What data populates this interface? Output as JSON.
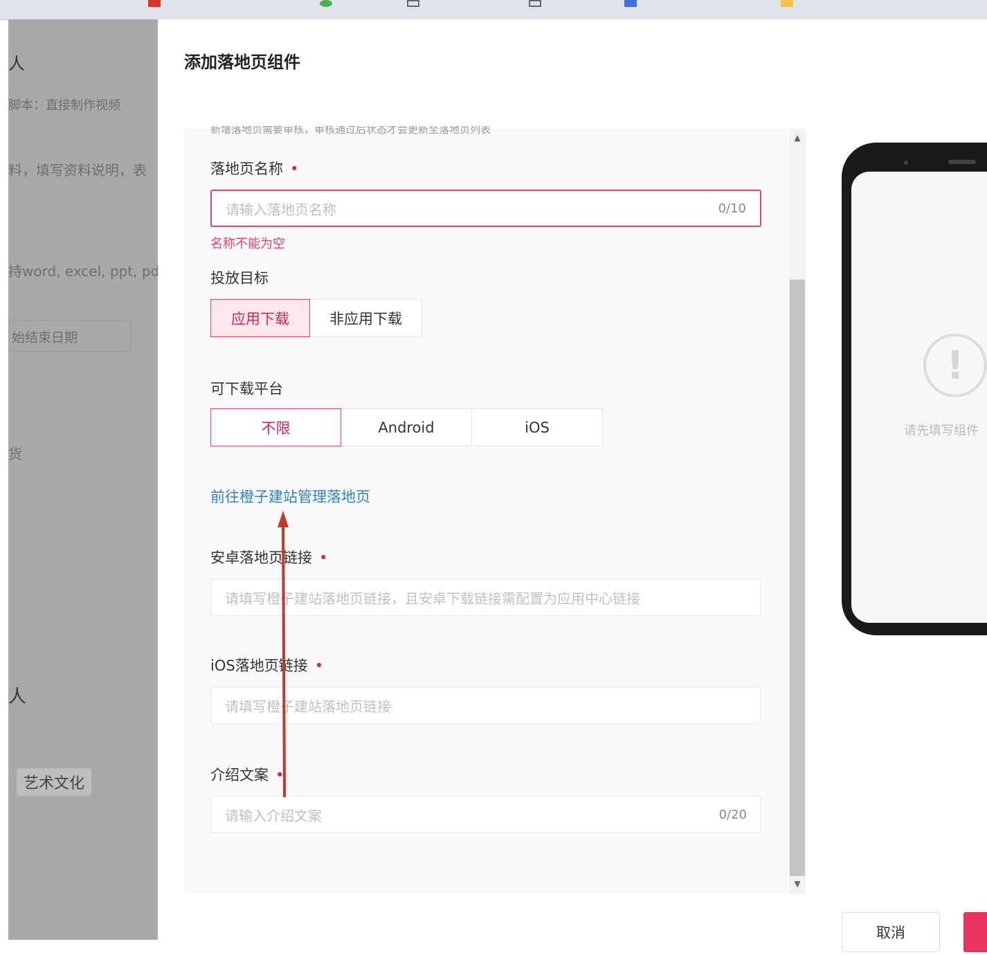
{
  "background_page": {
    "snippets": [
      " ",
      "脚本：直接制作视频",
      "料，填写资料说明，表",
      "持word, excel, ppt, pdf",
      "始结束日期",
      "货",
      "人",
      "艺术文化"
    ]
  },
  "drawer": {
    "title": "添加落地页组件",
    "cut_off_text": "新增落地页需要审核，审核通过后状态才会更新至落地页列表",
    "fields": {
      "name": {
        "label": "落地页名称",
        "placeholder": "请输入落地页名称",
        "counter": "0/10",
        "error": "名称不能为空"
      },
      "target": {
        "label": "投放目标",
        "options": [
          "应用下载",
          "非应用下载"
        ],
        "selected": "应用下载"
      },
      "platform": {
        "label": "可下载平台",
        "options": [
          "不限",
          "Android",
          "iOS"
        ],
        "selected": "不限"
      },
      "manage_link": "前往橙子建站管理落地页",
      "android_url": {
        "label": "安卓落地页链接",
        "placeholder": "请填写橙子建站落地页链接，且安卓下载链接需配置为应用中心链接"
      },
      "ios_url": {
        "label": "iOS落地页链接",
        "placeholder": "请填写橙子建站落地页链接"
      },
      "intro": {
        "label": "介绍文案",
        "placeholder": "请输入介绍文案",
        "counter": "0/20"
      }
    },
    "required_mark": "•",
    "preview": {
      "tip": "请先填写组件"
    },
    "buttons": {
      "cancel": "取消"
    }
  },
  "colors": {
    "accent": "#e0436f",
    "link": "#2f80c8",
    "annotation_arrow": "#c0392b"
  }
}
